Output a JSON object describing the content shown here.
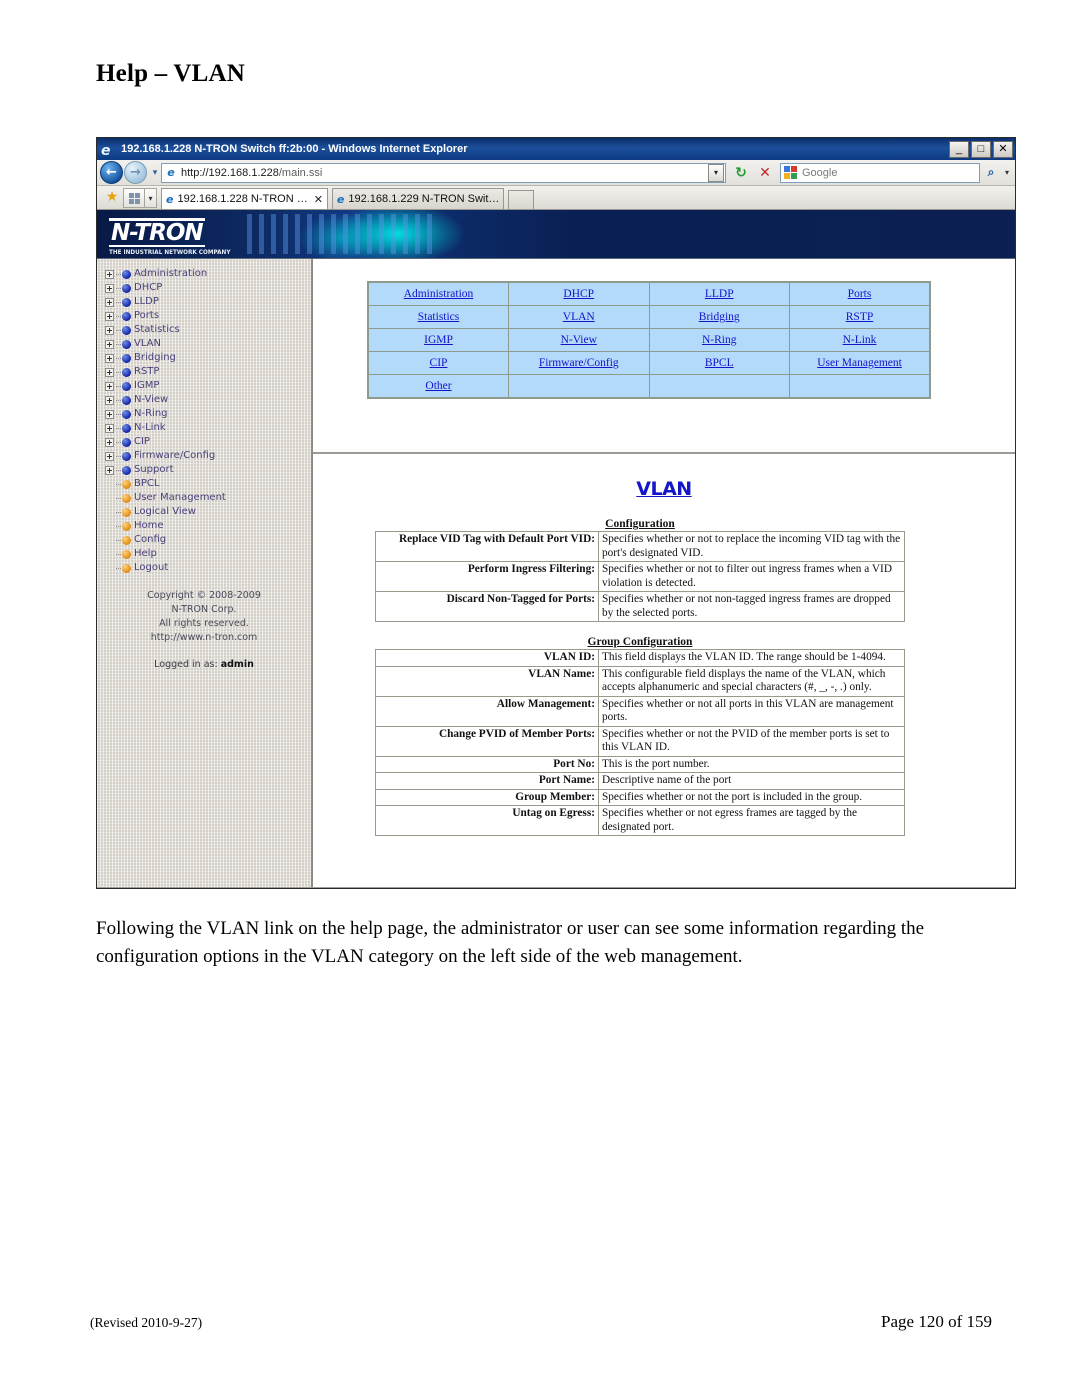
{
  "document": {
    "title": "Help – VLAN",
    "paragraph": "Following the VLAN link on the help page, the administrator or user can see some information regarding the configuration options in the VLAN category on the left side of the web management.",
    "footer_left": "(Revised 2010-9-27)",
    "footer_right": "Page 120 of 159"
  },
  "browser": {
    "title_bar": "192.168.1.228 N-TRON Switch ff:2b:00 - Windows Internet Explorer",
    "window_buttons": {
      "minimize": "_",
      "maximize": "□",
      "close": "✕"
    },
    "address": {
      "protocol_host": "http://192.168.1.228",
      "path": "/main.ssi",
      "full": "http://192.168.1.228/main.ssi"
    },
    "toolbar": {
      "back": "←",
      "forward": "→",
      "recent_pages_caret": "▾",
      "address_dropdown": "▾",
      "refresh": "↻",
      "stop": "✕",
      "search_placeholder": "Google",
      "search_go": "⌕",
      "search_dropdown": "▾"
    },
    "tabs": [
      {
        "label": "192.168.1.228 N-TRON …",
        "active": true,
        "close": "✕"
      },
      {
        "label": "192.168.1.229 N-TRON Swit…",
        "active": false
      }
    ],
    "favorites_star": "★",
    "quick_tabs_caret": "▾"
  },
  "banner": {
    "logo_word": "N-TRON",
    "logo_tagline": "THE INDUSTRIAL NETWORK COMPANY"
  },
  "sidebar": {
    "expandable_items": [
      "Administration",
      "DHCP",
      "LLDP",
      "Ports",
      "Statistics",
      "VLAN",
      "Bridging",
      "RSTP",
      "IGMP",
      "N-View",
      "N-Ring",
      "N-Link",
      "CIP",
      "Firmware/Config",
      "Support"
    ],
    "leaf_items": [
      "BPCL",
      "User Management",
      "Logical View",
      "Home",
      "Config",
      "Help",
      "Logout"
    ],
    "copyright_lines": [
      "Copyright © 2008-2009",
      "N-TRON Corp.",
      "All rights reserved.",
      "http://www.n-tron.com"
    ],
    "logged_in_prefix": "Logged in as:",
    "logged_in_user": "admin"
  },
  "help_index": {
    "rows": [
      [
        "Administration",
        "DHCP",
        "LLDP",
        "Ports"
      ],
      [
        "Statistics",
        "VLAN",
        "Bridging",
        "RSTP"
      ],
      [
        "IGMP",
        "N-View",
        "N-Ring",
        "N-Link"
      ],
      [
        "CIP",
        "Firmware/Config",
        "BPCL",
        "User Management"
      ],
      [
        "Other",
        "",
        "",
        ""
      ]
    ]
  },
  "vlan_help": {
    "heading": "VLAN",
    "sections": [
      {
        "caption": "Configuration",
        "rows": [
          {
            "term": "Replace VID Tag with Default Port VID:",
            "desc": "Specifies whether or not to replace the incoming VID tag with the port's designated VID."
          },
          {
            "term": "Perform Ingress Filtering:",
            "desc": "Specifies whether or not to filter out ingress frames when a VID violation is detected."
          },
          {
            "term": "Discard Non-Tagged for Ports:",
            "desc": "Specifies whether or not non-tagged ingress frames are dropped by the selected ports."
          }
        ]
      },
      {
        "caption": "Group Configuration",
        "rows": [
          {
            "term": "VLAN ID:",
            "desc": "This field displays the VLAN ID. The range should be 1-4094."
          },
          {
            "term": "VLAN Name:",
            "desc": "This configurable field displays the name of the VLAN, which accepts alphanumeric and special characters (#, _, -, .) only."
          },
          {
            "term": "Allow Management:",
            "desc": "Specifies whether or not all ports in this VLAN are management ports."
          },
          {
            "term": "Change PVID of Member Ports:",
            "desc": "Specifies whether or not the PVID of the member ports is set to this VLAN ID."
          },
          {
            "term": "Port No:",
            "desc": "This is the port number."
          },
          {
            "term": "Port Name:",
            "desc": "Descriptive name of the port"
          },
          {
            "term": "Group Member:",
            "desc": "Specifies whether or not the port is included in the group."
          },
          {
            "term": "Untag on Egress:",
            "desc": "Specifies whether or not egress frames are tagged by the designated port."
          }
        ]
      }
    ]
  },
  "colors": {
    "link_blue": "#1414c8",
    "table_cell_blue": "#b3d9fb",
    "banner_navy": "#0b1f52",
    "sidebar_grey": "#d4d0c8",
    "tree_text": "#4a3f7a"
  }
}
